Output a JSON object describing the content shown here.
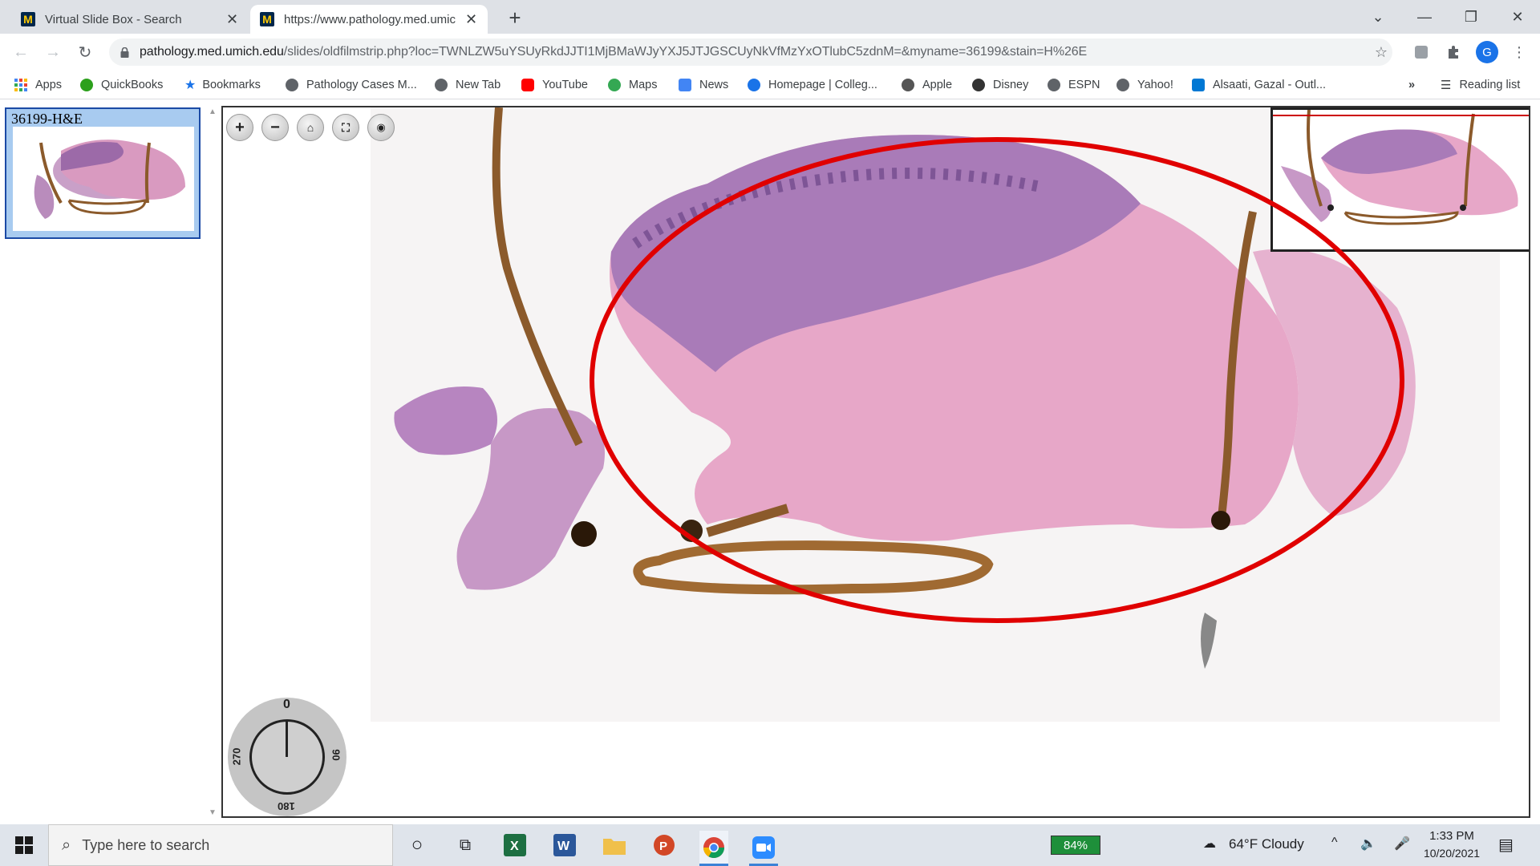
{
  "browser": {
    "tabs": [
      {
        "title": "Virtual Slide Box - Search",
        "favicon": "M"
      },
      {
        "title": "https://www.pathology.med.umic",
        "favicon": "M"
      }
    ],
    "url_host": "pathology.med.umich.edu",
    "url_path": "/slides/oldfilmstrip.php?loc=TWNLZW5uYSUyRkdJJTI1MjBMaWJyYXJ5JTJGSCUyNkVfMzYxOTlubC5zdnM=&myname=36199&stain=H%26E"
  },
  "bookmarks": [
    {
      "label": "Apps",
      "color": "#ea4335"
    },
    {
      "label": "QuickBooks",
      "color": "#2ca01c"
    },
    {
      "label": "Bookmarks",
      "color": "#1a73e8"
    },
    {
      "label": "Pathology Cases M...",
      "color": "#5f6368"
    },
    {
      "label": "New Tab",
      "color": "#5f6368"
    },
    {
      "label": "YouTube",
      "color": "#ff0000"
    },
    {
      "label": "Maps",
      "color": "#34a853"
    },
    {
      "label": "News",
      "color": "#4285f4"
    },
    {
      "label": "Homepage | Colleg...",
      "color": "#1a73e8"
    },
    {
      "label": "Apple",
      "color": "#555555"
    },
    {
      "label": "Disney",
      "color": "#333333"
    },
    {
      "label": "ESPN",
      "color": "#5f6368"
    },
    {
      "label": "Yahoo!",
      "color": "#5f6368"
    },
    {
      "label": "Alsaati, Gazal - Outl...",
      "color": "#0078d4"
    }
  ],
  "bookmarks_more": "»",
  "reading_list": "Reading list",
  "viewer": {
    "filmstrip_label": "36199-H&E",
    "rotation": {
      "top": "0",
      "right": "90",
      "bottom": "180",
      "left": "270"
    }
  },
  "taskbar": {
    "search_placeholder": "Type here to search",
    "battery": "84%",
    "weather": "64°F  Cloudy",
    "time": "1:33 PM",
    "date": "10/20/2021"
  },
  "icons": [
    "windows-icon",
    "search-icon",
    "cortana-icon",
    "task-view-icon",
    "excel-icon",
    "word-icon",
    "file-explorer-icon",
    "powerpoint-icon",
    "chrome-icon",
    "zoom-icon"
  ]
}
